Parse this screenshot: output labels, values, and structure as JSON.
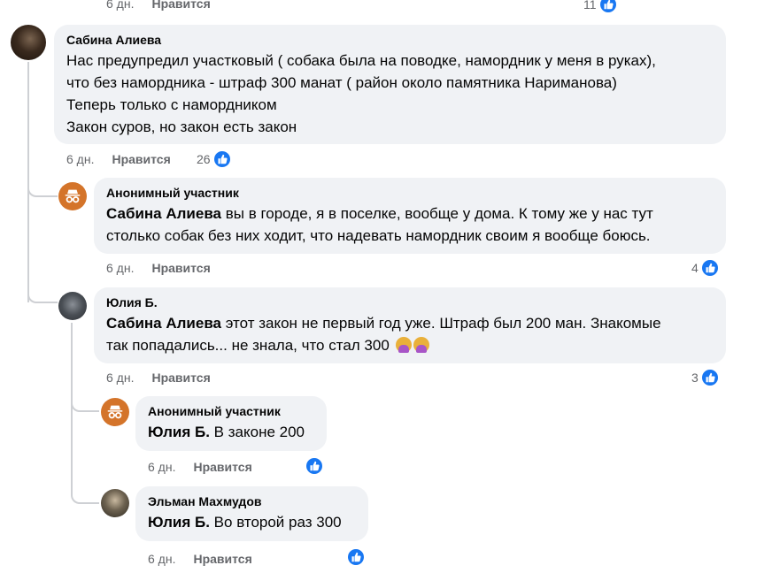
{
  "top": {
    "time": "6 дн.",
    "like": "Нравится",
    "count": "11"
  },
  "c1": {
    "author": "Сабина Алиева",
    "lines": [
      "Нас предупредил участковый ( собака была на поводке, намордник у меня в руках),",
      "что без намордника - штраф 300 манат ( район около памятника Нариманова)",
      "Теперь только с намордником",
      "Закон суров, но закон есть закон"
    ],
    "time": "6 дн.",
    "like": "Нравится",
    "count": "26"
  },
  "r1": {
    "author": "Анонимный участник",
    "mention": "Сабина Алиева",
    "line1": " вы в городе, я в поселке, вообще у дома. К тому же у нас тут",
    "line2": "столько собак без них ходит, что надевать намордник своим я вообще боюсь.",
    "time": "6 дн.",
    "like": "Нравится",
    "count": "4"
  },
  "r2": {
    "author": "Юлия Б.",
    "mention": "Сабина Алиева",
    "line1": " этот закон не первый год уже. Штраф был 200 ман. Знакомые",
    "line2": "так попадались... не знала, что стал 300",
    "emoji": "🤦‍♀️🤦‍♀️",
    "time": "6 дн.",
    "like": "Нравится",
    "count": "3"
  },
  "r3": {
    "author": "Анонимный участник",
    "mention": "Юлия Б.",
    "text": " В законе 200",
    "time": "6 дн.",
    "like": "Нравится"
  },
  "r4": {
    "author": "Эльман Махмудов",
    "mention": "Юлия Б.",
    "text": " Во второй раз 300",
    "time": "6 дн.",
    "like": "Нравится"
  },
  "colors": {
    "like_blue": "#1877f2",
    "bubble": "#f0f2f5",
    "meta": "#65676b",
    "anon_avatar": "#d4742a"
  }
}
